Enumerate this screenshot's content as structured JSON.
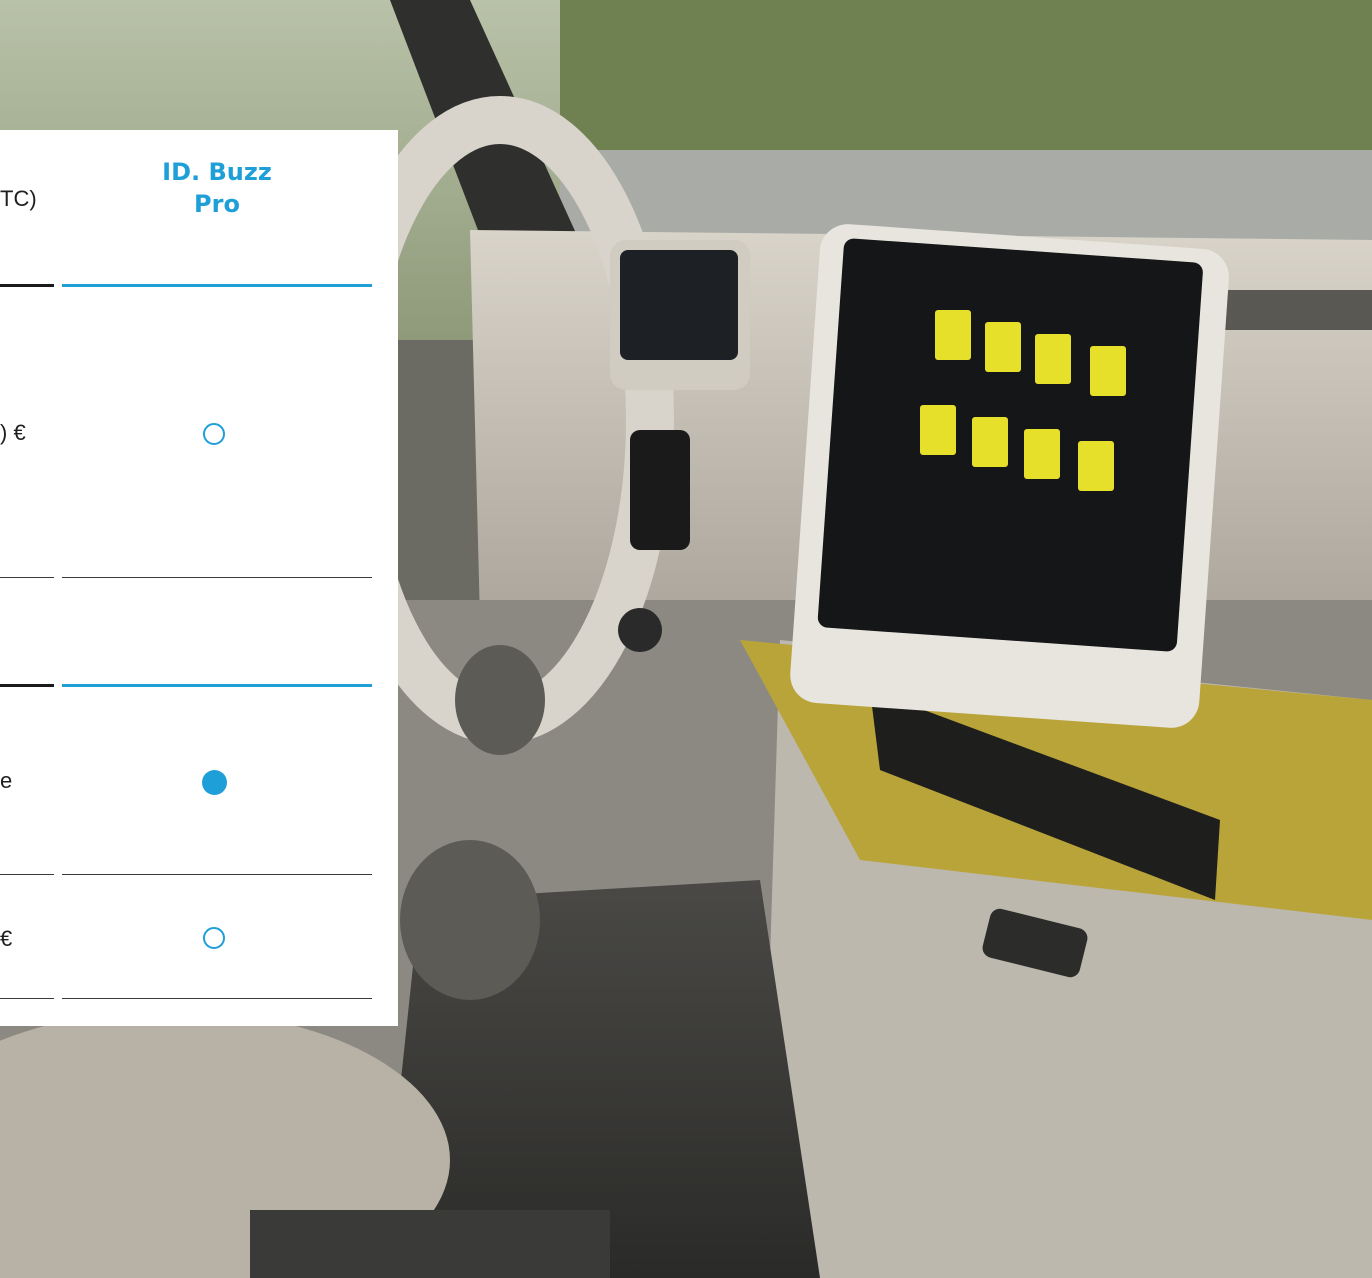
{
  "column": {
    "line1": "ID. Buzz",
    "line2": "Pro"
  },
  "left_cut": {
    "header": "TC)",
    "row1": ") €",
    "row3": "e",
    "row4": "€"
  },
  "rows": [
    {
      "name": "row-1",
      "marker": "optional"
    },
    {
      "name": "row-2",
      "marker": "none"
    },
    {
      "name": "row-3",
      "marker": "standard"
    },
    {
      "name": "row-4",
      "marker": "optional"
    }
  ],
  "colors": {
    "accent": "#1f9fd8",
    "text": "#1f1f1f",
    "panel": "#ffffff"
  }
}
